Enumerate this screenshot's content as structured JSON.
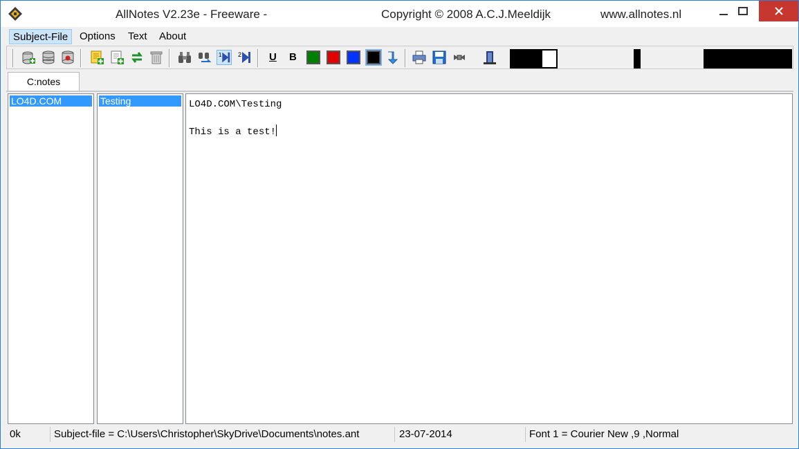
{
  "titlebar": {
    "app": "AllNotes V2.23e - Freeware -",
    "copyright": "Copyright © 2008 A.C.J.Meeldijk",
    "url": "www.allnotes.nl"
  },
  "menu": {
    "items": [
      "Subject-File",
      "Options",
      "Text",
      "About"
    ]
  },
  "toolbar": {
    "groups": [
      [
        "database-add-icon",
        "database-icon",
        "database-delete-icon"
      ],
      [
        "note-add-icon",
        "note-insert-icon",
        "swap-icon",
        "trash-icon"
      ],
      [
        "find-icon",
        "find-replace-icon",
        "sort-1-icon",
        "sort-2-icon"
      ],
      [
        "underline",
        "bold",
        "green",
        "red",
        "blue",
        "black",
        "down-arrow-icon"
      ],
      [
        "print-icon",
        "save-icon",
        "ribbon-icon",
        "exit-icon"
      ]
    ],
    "underline_label": "U",
    "bold_label": "B",
    "colors": {
      "green": "#008000",
      "red": "#e00000",
      "blue": "#0033ff",
      "black": "#000000"
    }
  },
  "tabs": [
    "C:notes"
  ],
  "subjects": [
    "LO4D.COM"
  ],
  "notes": [
    "Testing"
  ],
  "editor": {
    "line1": "LO4D.COM\\Testing",
    "line2": "",
    "line3": "This is a test!"
  },
  "status": {
    "size": "0k",
    "file": "Subject-file = C:\\Users\\Christopher\\SkyDrive\\Documents\\notes.ant",
    "date": "23-07-2014",
    "font": "Font 1 = Courier New ,9 ,Normal"
  }
}
